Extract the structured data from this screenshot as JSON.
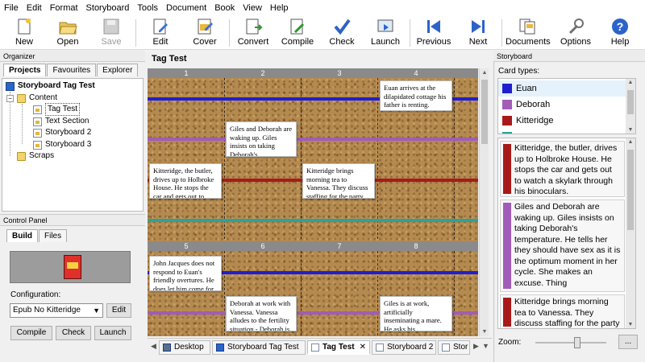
{
  "menu": [
    "File",
    "Edit",
    "Format",
    "Storyboard",
    "Tools",
    "Document",
    "Book",
    "View",
    "Help"
  ],
  "toolbar": {
    "new": "New",
    "open": "Open",
    "save": "Save",
    "edit": "Edit",
    "cover": "Cover",
    "convert": "Convert",
    "compile": "Compile",
    "check": "Check",
    "launch": "Launch",
    "previous": "Previous",
    "next": "Next",
    "documents": "Documents",
    "options": "Options",
    "help": "Help"
  },
  "organizer": {
    "title": "Organizer",
    "tabs": [
      "Projects",
      "Favourites",
      "Explorer"
    ],
    "tree": {
      "root": "Storyboard Tag Test",
      "content": "Content",
      "items": [
        "Tag Test",
        "Text Section",
        "Storyboard 2",
        "Storyboard 3"
      ],
      "scraps": "Scraps"
    }
  },
  "control_panel": {
    "title": "Control Panel",
    "tabs": [
      "Build",
      "Files"
    ],
    "configuration_label": "Configuration:",
    "configuration_value": "Epub No Kitteridge",
    "edit": "Edit",
    "compile": "Compile",
    "check": "Check",
    "launch": "Launch"
  },
  "board": {
    "title": "Tag Test",
    "top_columns": [
      "1",
      "2",
      "3",
      "4"
    ],
    "bottom_columns": [
      "5",
      "6",
      "7",
      "8"
    ],
    "cards": {
      "euan_arrives": "Euan arrives at the dilapidated cottage his father is renting.",
      "giles_deborah": "Giles and Deborah are waking up.  Giles insists on taking Deborah's",
      "kitteridge": "Kitteridge, the butler, drives up to Holbroke House. He stops the car and gets out to",
      "kitteridge_tea": "Kitteridge brings morning tea to Vanessa. They discuss staffing for the party",
      "john_jacques": "John Jacques does not respond to Euan's friendly overtures. He does let him come for",
      "deborah_work": "Deborah at work with Vanessa. Vanessa alludes to the fertility situation - Deborah is",
      "giles_work": "Giles is at work, artificially inseminating a mare. He asks his"
    }
  },
  "doc_tabs": [
    "Desktop",
    "Storyboard Tag Test",
    "Tag Test",
    "Storyboard 2",
    "Stor"
  ],
  "storyboard": {
    "title": "Storyboard",
    "card_types_label": "Card types:",
    "card_types": [
      {
        "name": "Euan",
        "color": "#1f1fd0"
      },
      {
        "name": "Deborah",
        "color": "#a15cb8"
      },
      {
        "name": "Kitteridge",
        "color": "#a81a1a"
      },
      {
        "name": "",
        "color": "#2aa398"
      }
    ],
    "synopses": [
      {
        "text": "Kitteridge, the butler, drives up to Holbroke House. He stops the car and gets out to watch a skylark through his binoculars.",
        "color": "#a81a1a"
      },
      {
        "text": "Giles and Deborah are waking up. Giles insists on taking Deborah's temperature. He tells her they should have sex as it is the optimum moment in her cycle. She makes an excuse. Thing",
        "color": "#a15cb8"
      },
      {
        "text": "Kitteridge brings morning tea to Vanessa. They discuss staffing for the party that",
        "color": "#a81a1a"
      }
    ],
    "zoom_label": "Zoom:",
    "more": "..."
  },
  "colors": {
    "euan": "#1f1fd0",
    "deborah": "#a15cb8",
    "kitteridge": "#a81a1a",
    "teal": "#2aa398"
  }
}
